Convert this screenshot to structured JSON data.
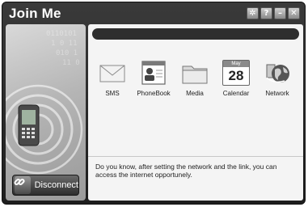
{
  "window": {
    "title": "Join Me"
  },
  "title_controls": [
    {
      "name": "settings-icon",
      "glyph": "✲"
    },
    {
      "name": "help-icon",
      "glyph": "?"
    },
    {
      "name": "minimize-icon",
      "glyph": "–"
    },
    {
      "name": "close-icon",
      "glyph": "✕"
    }
  ],
  "sidebar": {
    "disconnect_label": "Disconnect"
  },
  "apps": [
    {
      "label": "SMS",
      "icon": "envelope-icon"
    },
    {
      "label": "PhoneBook",
      "icon": "contact-card-icon"
    },
    {
      "label": "Media",
      "icon": "folder-icon"
    },
    {
      "label": "Calendar",
      "icon": "calendar-icon",
      "month": "May",
      "day": "28"
    },
    {
      "label": "Network",
      "icon": "globe-icon"
    }
  ],
  "tip": "Do you know, after setting the network and the link, you can access the internet opportunely."
}
